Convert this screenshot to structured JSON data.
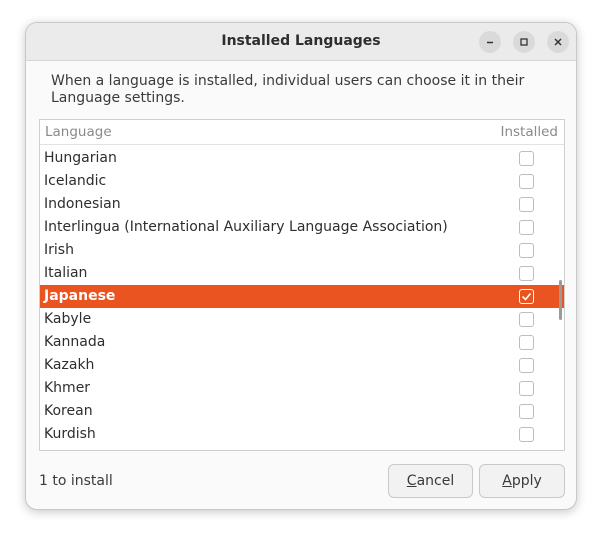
{
  "window": {
    "title": "Installed Languages"
  },
  "description": "When a language is installed, individual users can choose it in their Language settings.",
  "table": {
    "headers": {
      "language": "Language",
      "installed": "Installed"
    },
    "rows": [
      {
        "name": "Hungarian",
        "installed": false
      },
      {
        "name": "Icelandic",
        "installed": false
      },
      {
        "name": "Indonesian",
        "installed": false
      },
      {
        "name": "Interlingua (International Auxiliary Language Association)",
        "installed": false
      },
      {
        "name": "Irish",
        "installed": false
      },
      {
        "name": "Italian",
        "installed": false
      },
      {
        "name": "Japanese",
        "installed": true,
        "selected": true
      },
      {
        "name": "Kabyle",
        "installed": false
      },
      {
        "name": "Kannada",
        "installed": false
      },
      {
        "name": "Kazakh",
        "installed": false
      },
      {
        "name": "Khmer",
        "installed": false
      },
      {
        "name": "Korean",
        "installed": false
      },
      {
        "name": "Kurdish",
        "installed": false
      }
    ]
  },
  "status": "1 to install",
  "buttons": {
    "cancel_first": "C",
    "cancel_rest": "ancel",
    "apply_first": "A",
    "apply_rest": "pply"
  },
  "colors": {
    "accent": "#e95420"
  }
}
